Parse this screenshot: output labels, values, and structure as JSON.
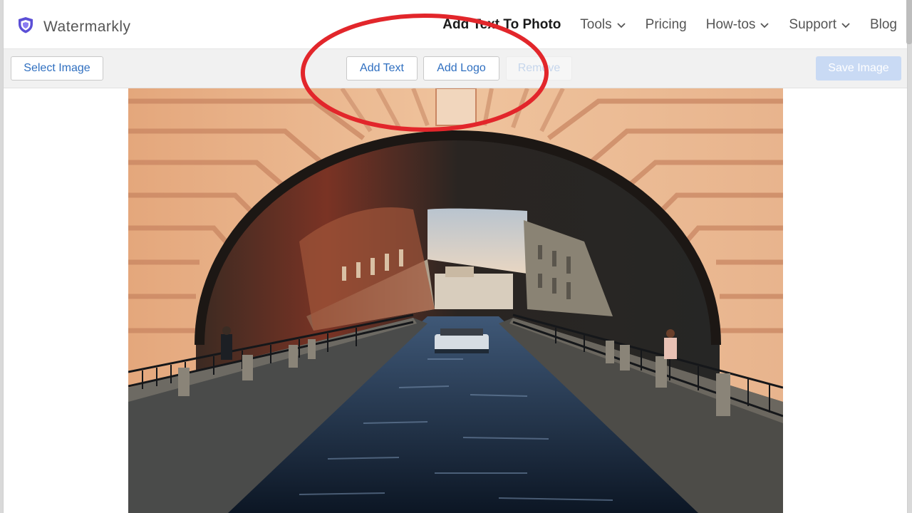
{
  "brand": {
    "name": "Watermarkly"
  },
  "nav": {
    "items": [
      {
        "label": "Add Text To Photo",
        "dropdown": false,
        "active": true
      },
      {
        "label": "Tools",
        "dropdown": true,
        "active": false
      },
      {
        "label": "Pricing",
        "dropdown": false,
        "active": false
      },
      {
        "label": "How-tos",
        "dropdown": true,
        "active": false
      },
      {
        "label": "Support",
        "dropdown": true,
        "active": false
      },
      {
        "label": "Blog",
        "dropdown": false,
        "active": false
      }
    ]
  },
  "toolbar": {
    "select_image": "Select Image",
    "add_text": "Add Text",
    "add_logo": "Add Logo",
    "remove": "Remove",
    "save_image": "Save Image"
  },
  "colors": {
    "accent": "#2f6fc0",
    "highlight_circle": "#e2262b",
    "brand_shield": "#5b4fd6"
  },
  "icons": {
    "brand": "shield-logo-icon",
    "dropdown": "chevron-down-icon"
  }
}
